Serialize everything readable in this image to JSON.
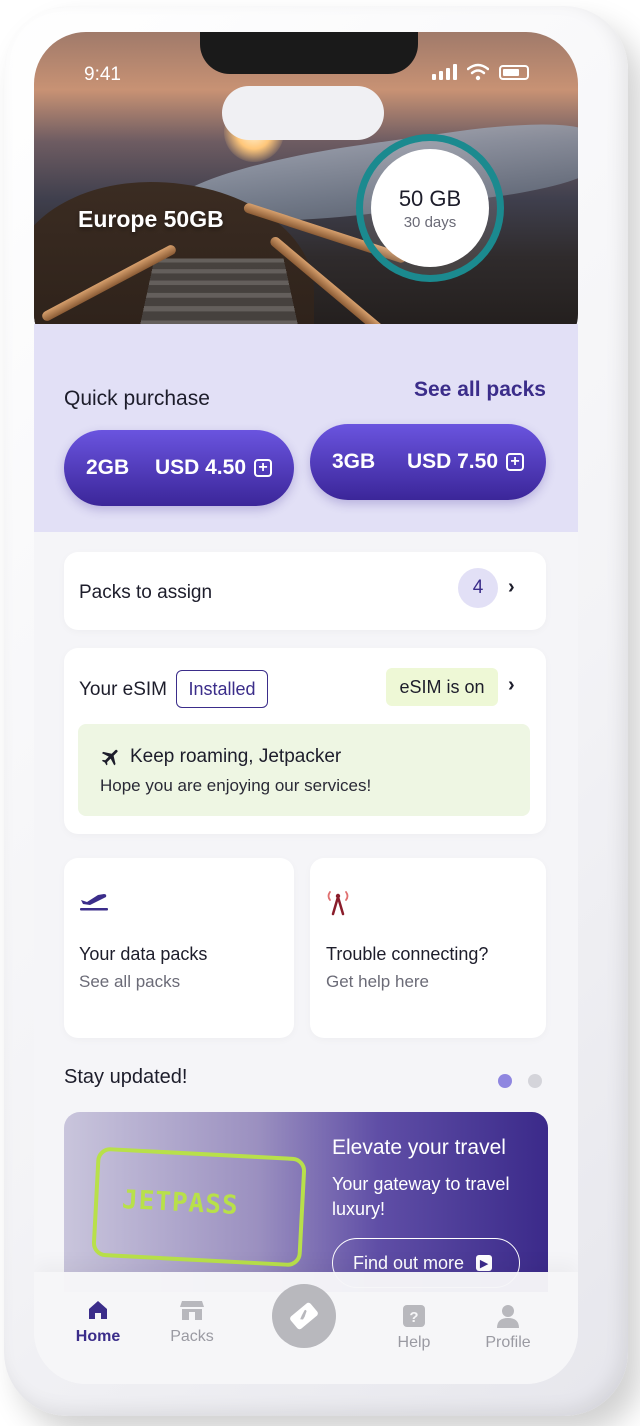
{
  "status": {
    "time": "9:41"
  },
  "hero": {
    "title": "Europe 50GB",
    "data_amount": "50 GB",
    "validity": "30 days"
  },
  "quick_purchase": {
    "title": "Quick purchase",
    "see_all": "See all packs",
    "packs": [
      {
        "size": "2GB",
        "price": "USD 4.50"
      },
      {
        "size": "3GB",
        "price": "USD 7.50"
      }
    ]
  },
  "packs_to_assign": {
    "label": "Packs to assign",
    "count": "4"
  },
  "esim": {
    "label": "Your eSIM",
    "install_status": "Installed",
    "state": "eSIM is on",
    "message_title": "Keep roaming, Jetpacker",
    "message_body": "Hope you are enjoying our services!"
  },
  "tiles": [
    {
      "title": "Your data packs",
      "subtitle": "See all packs",
      "icon": "plane-icon"
    },
    {
      "title": "Trouble connecting?",
      "subtitle": "Get help here",
      "icon": "antenna-icon"
    }
  ],
  "updates": {
    "title": "Stay updated!",
    "banner_title": "Elevate your travel",
    "banner_subtitle": "Your gateway to travel luxury!",
    "banner_cta": "Find out more",
    "stamp_text": "JETPASS"
  },
  "tabbar": {
    "items": [
      {
        "label": "Home",
        "active": true
      },
      {
        "label": "Packs",
        "active": false
      },
      {
        "label": "Help",
        "active": false
      },
      {
        "label": "Profile",
        "active": false
      }
    ]
  },
  "colors": {
    "primary": "#3b2d8a",
    "accent_gradient_top": "#6a54df",
    "quick_purchase_bg": "#e2e0f6",
    "esim_on_bg": "#eef8d6",
    "ring": "#1b8a8f"
  }
}
